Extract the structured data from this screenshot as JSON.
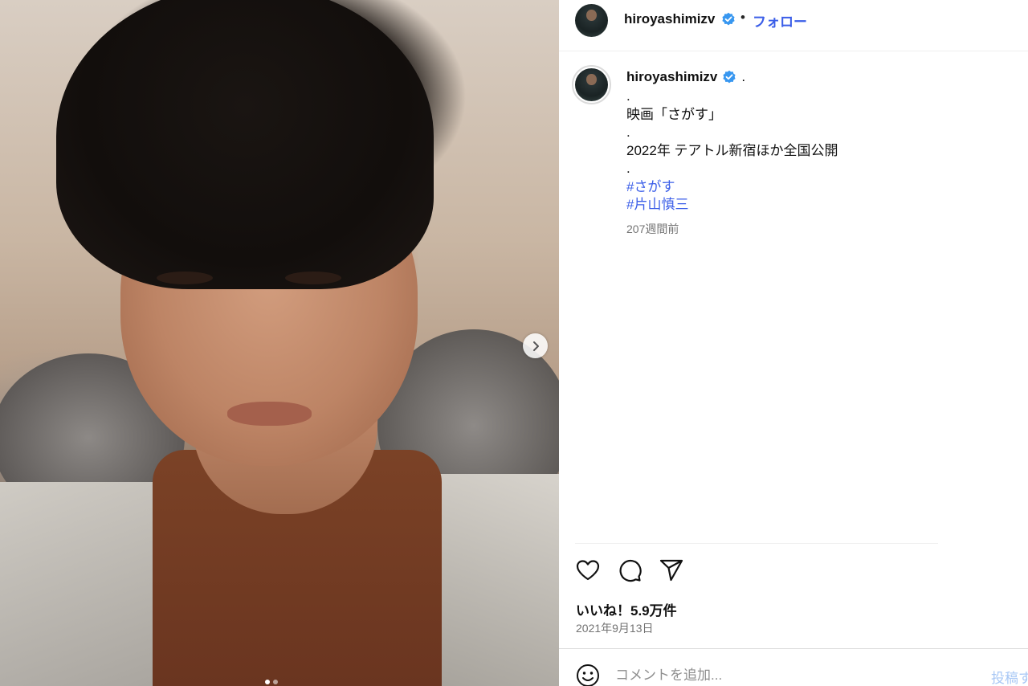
{
  "header": {
    "username": "hiroyashimizv",
    "separator": "•",
    "follow_label": "フォロー"
  },
  "caption": {
    "username": "hiroyashimizv",
    "first_line": ".",
    "lines": [
      ".",
      "映画「さがす」",
      ".",
      "2022年 テアトル新宿ほか全国公開",
      "."
    ],
    "hashtags": [
      "#さがす",
      "#片山慎三"
    ],
    "time_ago": "207週間前"
  },
  "actions": {
    "like_icon": "heart-icon",
    "comment_icon": "comment-icon",
    "share_icon": "share-icon"
  },
  "likes_text": "いいね！5.9万件",
  "date_text": "2021年9月13日",
  "comment": {
    "placeholder": "コメントを追加...",
    "post_label": "投稿す"
  },
  "carousel": {
    "total": 2,
    "active": 1,
    "next_icon": "chevron-right-icon"
  },
  "colors": {
    "link_blue": "#3b5ee8",
    "verified_blue": "#3897f0",
    "muted_gray": "#737373"
  }
}
